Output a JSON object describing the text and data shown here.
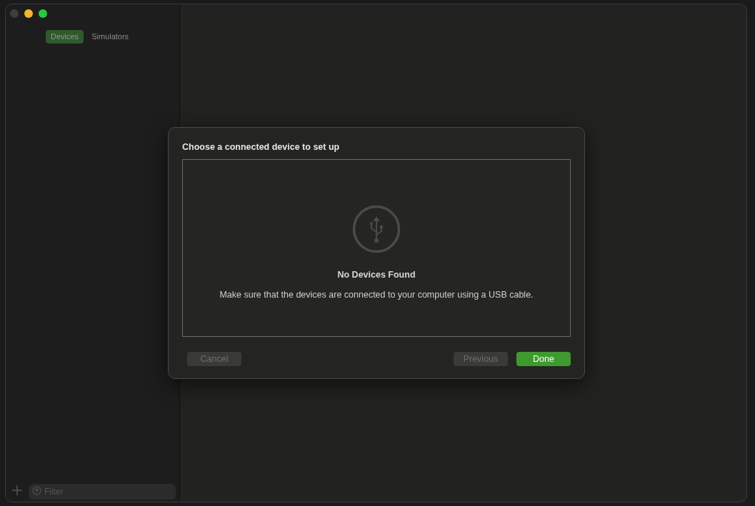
{
  "window": {
    "controls": [
      {
        "kind": "close",
        "disabled": true
      },
      {
        "kind": "minimize",
        "disabled": false
      },
      {
        "kind": "zoom",
        "disabled": false
      }
    ]
  },
  "sidebar": {
    "tabs": [
      {
        "label": "Devices",
        "selected": true
      },
      {
        "label": "Simulators",
        "selected": false
      }
    ],
    "filter": {
      "placeholder": "Filter"
    }
  },
  "dialog": {
    "title": "Choose a connected device to set up",
    "empty_state": {
      "heading": "No Devices Found",
      "message": "Make sure that the devices are connected to your computer using a USB cable."
    },
    "buttons": [
      {
        "label": "Cancel",
        "disabled": true,
        "kind": "secondary"
      },
      {
        "label": "Previous",
        "disabled": true,
        "kind": "secondary"
      },
      {
        "label": "Done",
        "disabled": false,
        "kind": "primary"
      }
    ]
  }
}
